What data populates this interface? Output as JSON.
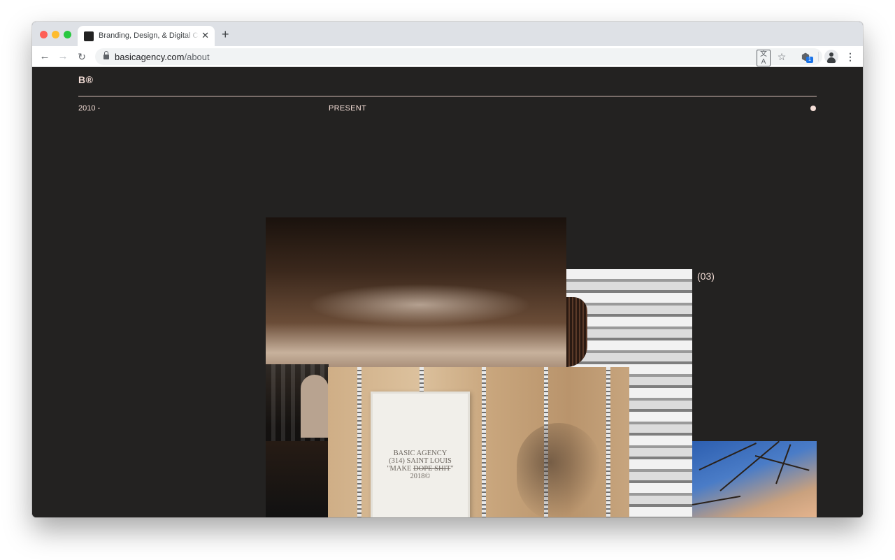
{
  "browser": {
    "tab_title": "Branding, Design, & Digital Creative Agency",
    "tab_close": "✕",
    "new_tab": "+",
    "url_host": "basicagency.com",
    "url_path": "/about",
    "extension_badge": "1",
    "nav_icons": {
      "back": "←",
      "forward": "→",
      "reload": "↻",
      "star": "☆",
      "menu": "⋮",
      "translate": "文A",
      "extension": "⬢"
    }
  },
  "page": {
    "logo": "B®",
    "year_range": "2010 -",
    "present": "PRESENT",
    "counter": "(03)",
    "poster": {
      "line1": "BASIC AGENCY",
      "line2": "(314) SAINT LOUIS",
      "line3_prefix": "\"MAKE ",
      "line3_strike": "DOPE SHIT",
      "line3_suffix": "\"",
      "line4": "2018©"
    }
  },
  "colors": {
    "background": "#232221",
    "accent_text": "#f3ddd6",
    "chrome_tabstrip": "#dee1e6"
  }
}
